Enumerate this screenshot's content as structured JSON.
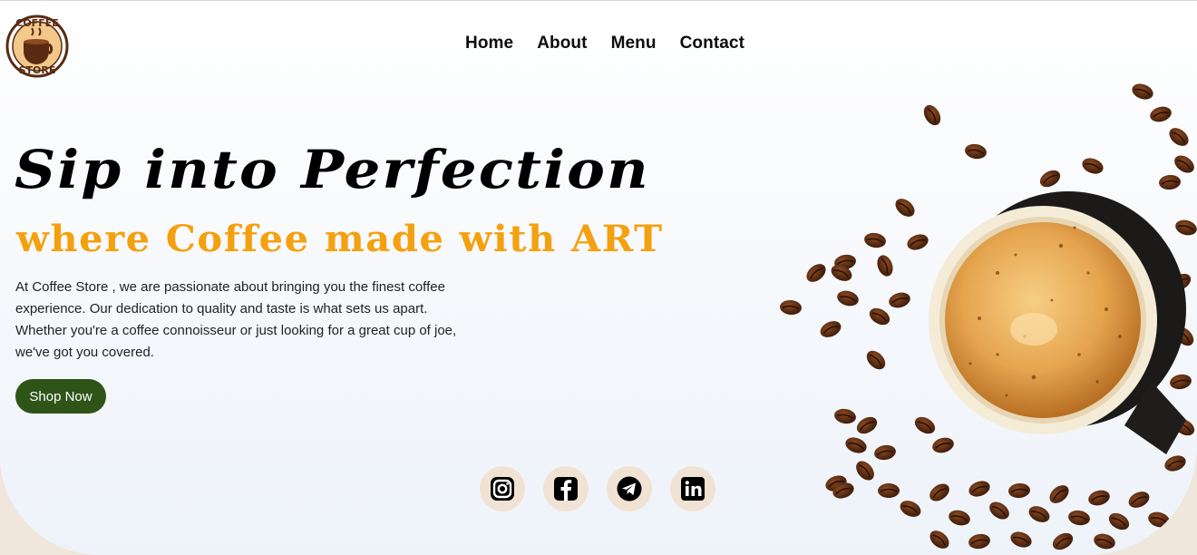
{
  "brand": {
    "logo_top": "COFFEE",
    "logo_bottom": "STORE"
  },
  "nav": [
    {
      "label": "Home"
    },
    {
      "label": "About"
    },
    {
      "label": "Menu"
    },
    {
      "label": "Contact"
    }
  ],
  "hero": {
    "headline": "Sip into Perfection",
    "subhead": "where Coffee made with ART",
    "description": "At Coffee Store , we are passionate about bringing you the finest coffee experience. Our dedication to quality and taste is what sets us apart. Whether you're a coffee connoisseur or just looking for a great cup of joe, we've got you covered.",
    "cta_label": "Shop Now"
  },
  "socials": [
    {
      "icon": "instagram-icon"
    },
    {
      "icon": "facebook-icon"
    },
    {
      "icon": "telegram-icon"
    },
    {
      "icon": "linkedin-icon"
    }
  ],
  "colors": {
    "accent": "#f5a00e",
    "button": "#2f5418",
    "social_bg": "#f1e3d3",
    "coffee": "#5a2a12"
  }
}
